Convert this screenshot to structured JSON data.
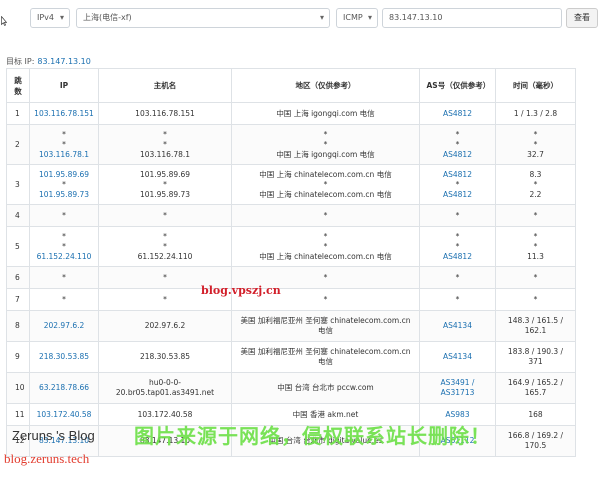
{
  "toolbar": {
    "ip_version": "IPv4",
    "node": "上海(电信-xf)",
    "protocol": "ICMP",
    "target": "83.147.13.10",
    "query_button": "查看"
  },
  "target_line": {
    "label": "目标 IP:",
    "ip": "83.147.13.10"
  },
  "table": {
    "headers": {
      "hop": "跳数",
      "ip": "IP",
      "host": "主机名",
      "region": "地区（仅供参考）",
      "asn": "AS号（仅供参考）",
      "time": "时间（毫秒）"
    },
    "rows": [
      {
        "hop": "1",
        "ip": [
          "103.116.78.151"
        ],
        "host": [
          "103.116.78.151"
        ],
        "region": [
          "中国 上海 igongqi.com 电信"
        ],
        "asn": [
          "AS4812"
        ],
        "time": [
          "1 / 1.3 / 2.8"
        ]
      },
      {
        "hop": "2",
        "ip": [
          "*",
          "*",
          "103.116.78.1"
        ],
        "host": [
          "*",
          "*",
          "103.116.78.1"
        ],
        "region": [
          "*",
          "*",
          "中国 上海 igongqi.com 电信"
        ],
        "asn": [
          "*",
          "*",
          "AS4812"
        ],
        "time": [
          "*",
          "*",
          "32.7"
        ]
      },
      {
        "hop": "3",
        "ip": [
          "101.95.89.69",
          "*",
          "101.95.89.73"
        ],
        "host": [
          "101.95.89.69",
          "*",
          "101.95.89.73"
        ],
        "region": [
          "中国 上海 chinatelecom.com.cn 电信",
          "*",
          "中国 上海 chinatelecom.com.cn 电信"
        ],
        "asn": [
          "AS4812",
          "*",
          "AS4812"
        ],
        "time": [
          "8.3",
          "*",
          "2.2"
        ]
      },
      {
        "hop": "4",
        "ip": [
          "*"
        ],
        "host": [
          "*"
        ],
        "region": [
          "*"
        ],
        "asn": [
          "*"
        ],
        "time": [
          "*"
        ]
      },
      {
        "hop": "5",
        "ip": [
          "*",
          "*",
          "61.152.24.110"
        ],
        "host": [
          "*",
          "*",
          "61.152.24.110"
        ],
        "region": [
          "*",
          "*",
          "中国 上海 chinatelecom.com.cn 电信"
        ],
        "asn": [
          "*",
          "*",
          "AS4812"
        ],
        "time": [
          "*",
          "*",
          "11.3"
        ]
      },
      {
        "hop": "6",
        "ip": [
          "*"
        ],
        "host": [
          "*"
        ],
        "region": [
          "*"
        ],
        "asn": [
          "*"
        ],
        "time": [
          "*"
        ]
      },
      {
        "hop": "7",
        "ip": [
          "*"
        ],
        "host": [
          "*"
        ],
        "region": [
          "*"
        ],
        "asn": [
          "*"
        ],
        "time": [
          "*"
        ]
      },
      {
        "hop": "8",
        "ip": [
          "202.97.6.2"
        ],
        "host": [
          "202.97.6.2"
        ],
        "region": [
          "美国 加利福尼亚州 圣何塞 chinatelecom.com.cn",
          "电信"
        ],
        "asn": [
          "AS4134"
        ],
        "time": [
          "148.3 / 161.5 /",
          "162.1"
        ]
      },
      {
        "hop": "9",
        "ip": [
          "218.30.53.85"
        ],
        "host": [
          "218.30.53.85"
        ],
        "region": [
          "美国 加利福尼亚州 圣何塞 chinatelecom.com.cn",
          "电信"
        ],
        "asn": [
          "AS4134"
        ],
        "time": [
          "183.8 / 190.3 /",
          "371"
        ]
      },
      {
        "hop": "10",
        "ip": [
          "63.218.78.66"
        ],
        "host": [
          "hu0-0-0-",
          "20.br05.tap01.as3491.net"
        ],
        "region": [
          "中国 台湾 台北市 pccw.com"
        ],
        "asn": [
          "AS3491 /",
          "AS31713"
        ],
        "time": [
          "164.9 / 165.2 /",
          "165.7"
        ]
      },
      {
        "hop": "11",
        "ip": [
          "103.172.40.58"
        ],
        "host": [
          "103.172.40.58"
        ],
        "region": [
          "中国 香港 akm.net"
        ],
        "asn": [
          "AS983"
        ],
        "time": [
          "168"
        ]
      },
      {
        "hop": "12",
        "ip": [
          "83.147.13.10"
        ],
        "host": [
          "83.147.13.10"
        ],
        "region": [
          "中国 台湾 台北市 digitalvalue.es"
        ],
        "asn": [
          "AS61112"
        ],
        "time": [
          "166.8 / 169.2 /",
          "170.5"
        ]
      }
    ]
  },
  "watermarks": {
    "center": "blog.vpszj.cn",
    "zeruns": "Zeruns 's Blog",
    "zeruns_url": "blog.zeruns.tech",
    "banner": "图片来源于网络，侵权联系站长删除！"
  },
  "colors": {
    "link": "#1a6fb0",
    "watermark_red": "#d21f2a",
    "banner_green": "#6fe04a"
  }
}
